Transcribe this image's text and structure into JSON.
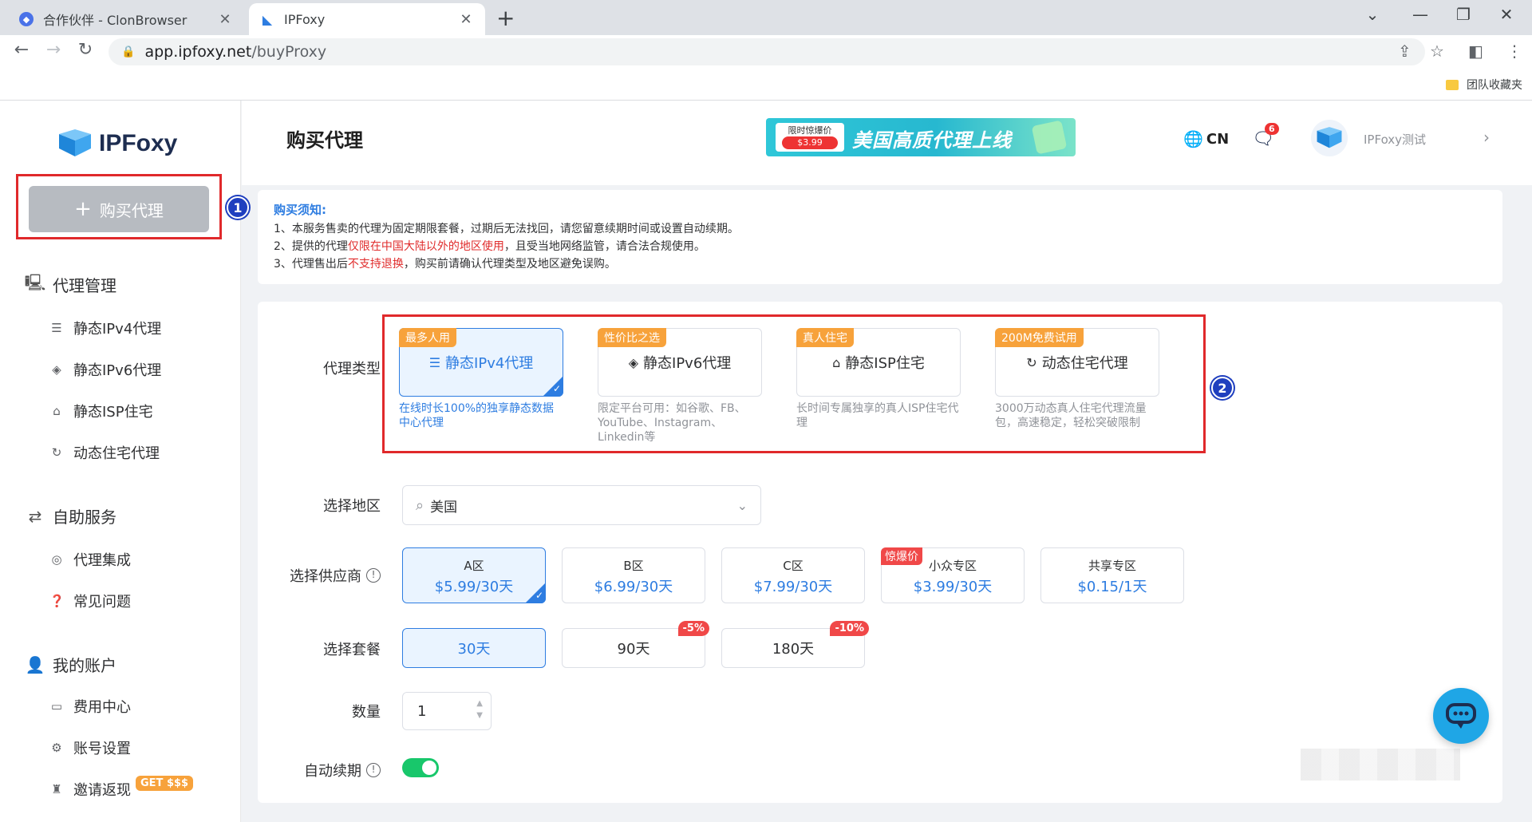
{
  "browser": {
    "tabs": [
      {
        "title": "合作伙伴 - ClonBrowser",
        "active": false
      },
      {
        "title": "IPFoxy",
        "active": true
      }
    ],
    "url_host": "app.ipfoxy.net",
    "url_path": "/buyProxy",
    "bookmark_folder": "团队收藏夹"
  },
  "sidebar": {
    "logo_text": "IPFoxy",
    "buy_button": "购买代理",
    "groups": [
      {
        "label": "代理管理",
        "icon": "monitor-icon",
        "items": [
          {
            "label": "静态IPv4代理",
            "icon": "server-icon"
          },
          {
            "label": "静态IPv6代理",
            "icon": "layers-icon"
          },
          {
            "label": "静态ISP住宅",
            "icon": "home-icon"
          },
          {
            "label": "动态住宅代理",
            "icon": "refresh-icon"
          }
        ]
      },
      {
        "label": "自助服务",
        "icon": "sync-icon",
        "items": [
          {
            "label": "代理集成",
            "icon": "fingerprint-icon"
          },
          {
            "label": "常见问题",
            "icon": "question-icon"
          }
        ]
      },
      {
        "label": "我的账户",
        "icon": "user-icon",
        "items": [
          {
            "label": "费用中心",
            "icon": "card-icon"
          },
          {
            "label": "账号设置",
            "icon": "gear-icon"
          },
          {
            "label": "邀请返现",
            "icon": "gift-icon",
            "badge": "GET $$$"
          }
        ]
      }
    ]
  },
  "callouts": [
    "1",
    "2"
  ],
  "header": {
    "title": "购买代理",
    "banner_tag_top": "限时惊爆价",
    "banner_tag_price": "$3.99",
    "banner_headline": "美国高质代理上线",
    "lang": "CN",
    "msg_count": "6",
    "user": "IPFoxy测试"
  },
  "notice": {
    "title": "购买须知:",
    "line1": "1、本服务售卖的代理为固定期限套餐，过期后无法找回，请您留意续期时间或设置自动续期。",
    "line2_a": "2、提供的代理",
    "line2_red": "仅限在中国大陆以外的地区使用",
    "line2_b": "，且受当地网络监管，请合法合规使用。",
    "line3_a": "3、代理售出后",
    "line3_red": "不支持退换",
    "line3_b": "，购买前请确认代理类型及地区避免误购。"
  },
  "form": {
    "labels": {
      "type": "代理类型",
      "region": "选择地区",
      "vendor": "选择供应商",
      "plan": "选择套餐",
      "qty": "数量",
      "renew": "自动续期"
    },
    "types": [
      {
        "ribbon": "最多人用",
        "name": "静态IPv4代理",
        "desc": "在线时长100%的独享静态数据中心代理",
        "selected": true,
        "icon": "server-icon"
      },
      {
        "ribbon": "性价比之选",
        "name": "静态IPv6代理",
        "desc": "限定平台可用：如谷歌、FB、YouTube、Instagram、Linkedin等",
        "selected": false,
        "icon": "layers-icon"
      },
      {
        "ribbon": "真人住宅",
        "name": "静态ISP住宅",
        "desc": "长时间专属独享的真人ISP住宅代理",
        "selected": false,
        "icon": "home-icon"
      },
      {
        "ribbon": "200M免费试用",
        "name": "动态住宅代理",
        "desc": "3000万动态真人住宅代理流量包，高速稳定，轻松突破限制",
        "selected": false,
        "icon": "refresh-icon"
      }
    ],
    "region_value": "美国",
    "vendors": [
      {
        "name": "A区",
        "price": "$5.99/30天",
        "selected": true,
        "hot": ""
      },
      {
        "name": "B区",
        "price": "$6.99/30天",
        "selected": false,
        "hot": ""
      },
      {
        "name": "C区",
        "price": "$7.99/30天",
        "selected": false,
        "hot": ""
      },
      {
        "name": "小众专区",
        "price": "$3.99/30天",
        "selected": false,
        "hot": "惊爆价"
      },
      {
        "name": "共享专区",
        "price": "$0.15/1天",
        "selected": false,
        "hot": ""
      }
    ],
    "plans": [
      {
        "label": "30天",
        "selected": true,
        "discount": ""
      },
      {
        "label": "90天",
        "selected": false,
        "discount": "-5%"
      },
      {
        "label": "180天",
        "selected": false,
        "discount": "-10%"
      }
    ],
    "qty_value": "1",
    "auto_renew": true
  },
  "colors": {
    "accent": "#2e7de1",
    "highlight": "#e0292b",
    "toggle_on": "#18c76b",
    "ribbon": "#f7a23b"
  }
}
